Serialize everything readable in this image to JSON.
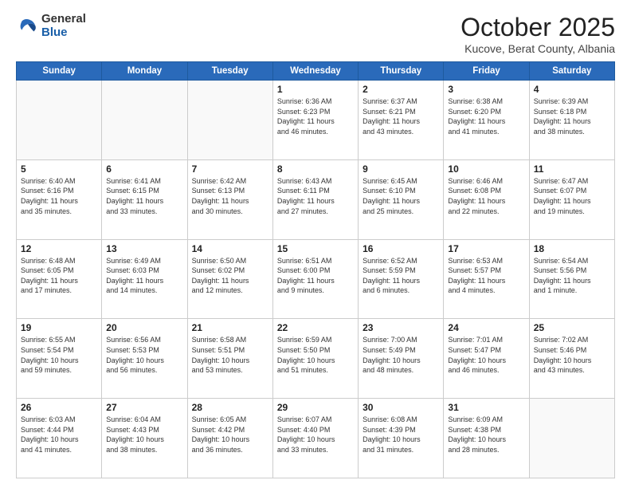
{
  "header": {
    "logo_general": "General",
    "logo_blue": "Blue",
    "month_title": "October 2025",
    "location": "Kucove, Berat County, Albania"
  },
  "days_of_week": [
    "Sunday",
    "Monday",
    "Tuesday",
    "Wednesday",
    "Thursday",
    "Friday",
    "Saturday"
  ],
  "weeks": [
    [
      {
        "day": "",
        "info": ""
      },
      {
        "day": "",
        "info": ""
      },
      {
        "day": "",
        "info": ""
      },
      {
        "day": "1",
        "info": "Sunrise: 6:36 AM\nSunset: 6:23 PM\nDaylight: 11 hours\nand 46 minutes."
      },
      {
        "day": "2",
        "info": "Sunrise: 6:37 AM\nSunset: 6:21 PM\nDaylight: 11 hours\nand 43 minutes."
      },
      {
        "day": "3",
        "info": "Sunrise: 6:38 AM\nSunset: 6:20 PM\nDaylight: 11 hours\nand 41 minutes."
      },
      {
        "day": "4",
        "info": "Sunrise: 6:39 AM\nSunset: 6:18 PM\nDaylight: 11 hours\nand 38 minutes."
      }
    ],
    [
      {
        "day": "5",
        "info": "Sunrise: 6:40 AM\nSunset: 6:16 PM\nDaylight: 11 hours\nand 35 minutes."
      },
      {
        "day": "6",
        "info": "Sunrise: 6:41 AM\nSunset: 6:15 PM\nDaylight: 11 hours\nand 33 minutes."
      },
      {
        "day": "7",
        "info": "Sunrise: 6:42 AM\nSunset: 6:13 PM\nDaylight: 11 hours\nand 30 minutes."
      },
      {
        "day": "8",
        "info": "Sunrise: 6:43 AM\nSunset: 6:11 PM\nDaylight: 11 hours\nand 27 minutes."
      },
      {
        "day": "9",
        "info": "Sunrise: 6:45 AM\nSunset: 6:10 PM\nDaylight: 11 hours\nand 25 minutes."
      },
      {
        "day": "10",
        "info": "Sunrise: 6:46 AM\nSunset: 6:08 PM\nDaylight: 11 hours\nand 22 minutes."
      },
      {
        "day": "11",
        "info": "Sunrise: 6:47 AM\nSunset: 6:07 PM\nDaylight: 11 hours\nand 19 minutes."
      }
    ],
    [
      {
        "day": "12",
        "info": "Sunrise: 6:48 AM\nSunset: 6:05 PM\nDaylight: 11 hours\nand 17 minutes."
      },
      {
        "day": "13",
        "info": "Sunrise: 6:49 AM\nSunset: 6:03 PM\nDaylight: 11 hours\nand 14 minutes."
      },
      {
        "day": "14",
        "info": "Sunrise: 6:50 AM\nSunset: 6:02 PM\nDaylight: 11 hours\nand 12 minutes."
      },
      {
        "day": "15",
        "info": "Sunrise: 6:51 AM\nSunset: 6:00 PM\nDaylight: 11 hours\nand 9 minutes."
      },
      {
        "day": "16",
        "info": "Sunrise: 6:52 AM\nSunset: 5:59 PM\nDaylight: 11 hours\nand 6 minutes."
      },
      {
        "day": "17",
        "info": "Sunrise: 6:53 AM\nSunset: 5:57 PM\nDaylight: 11 hours\nand 4 minutes."
      },
      {
        "day": "18",
        "info": "Sunrise: 6:54 AM\nSunset: 5:56 PM\nDaylight: 11 hours\nand 1 minute."
      }
    ],
    [
      {
        "day": "19",
        "info": "Sunrise: 6:55 AM\nSunset: 5:54 PM\nDaylight: 10 hours\nand 59 minutes."
      },
      {
        "day": "20",
        "info": "Sunrise: 6:56 AM\nSunset: 5:53 PM\nDaylight: 10 hours\nand 56 minutes."
      },
      {
        "day": "21",
        "info": "Sunrise: 6:58 AM\nSunset: 5:51 PM\nDaylight: 10 hours\nand 53 minutes."
      },
      {
        "day": "22",
        "info": "Sunrise: 6:59 AM\nSunset: 5:50 PM\nDaylight: 10 hours\nand 51 minutes."
      },
      {
        "day": "23",
        "info": "Sunrise: 7:00 AM\nSunset: 5:49 PM\nDaylight: 10 hours\nand 48 minutes."
      },
      {
        "day": "24",
        "info": "Sunrise: 7:01 AM\nSunset: 5:47 PM\nDaylight: 10 hours\nand 46 minutes."
      },
      {
        "day": "25",
        "info": "Sunrise: 7:02 AM\nSunset: 5:46 PM\nDaylight: 10 hours\nand 43 minutes."
      }
    ],
    [
      {
        "day": "26",
        "info": "Sunrise: 6:03 AM\nSunset: 4:44 PM\nDaylight: 10 hours\nand 41 minutes."
      },
      {
        "day": "27",
        "info": "Sunrise: 6:04 AM\nSunset: 4:43 PM\nDaylight: 10 hours\nand 38 minutes."
      },
      {
        "day": "28",
        "info": "Sunrise: 6:05 AM\nSunset: 4:42 PM\nDaylight: 10 hours\nand 36 minutes."
      },
      {
        "day": "29",
        "info": "Sunrise: 6:07 AM\nSunset: 4:40 PM\nDaylight: 10 hours\nand 33 minutes."
      },
      {
        "day": "30",
        "info": "Sunrise: 6:08 AM\nSunset: 4:39 PM\nDaylight: 10 hours\nand 31 minutes."
      },
      {
        "day": "31",
        "info": "Sunrise: 6:09 AM\nSunset: 4:38 PM\nDaylight: 10 hours\nand 28 minutes."
      },
      {
        "day": "",
        "info": ""
      }
    ]
  ]
}
